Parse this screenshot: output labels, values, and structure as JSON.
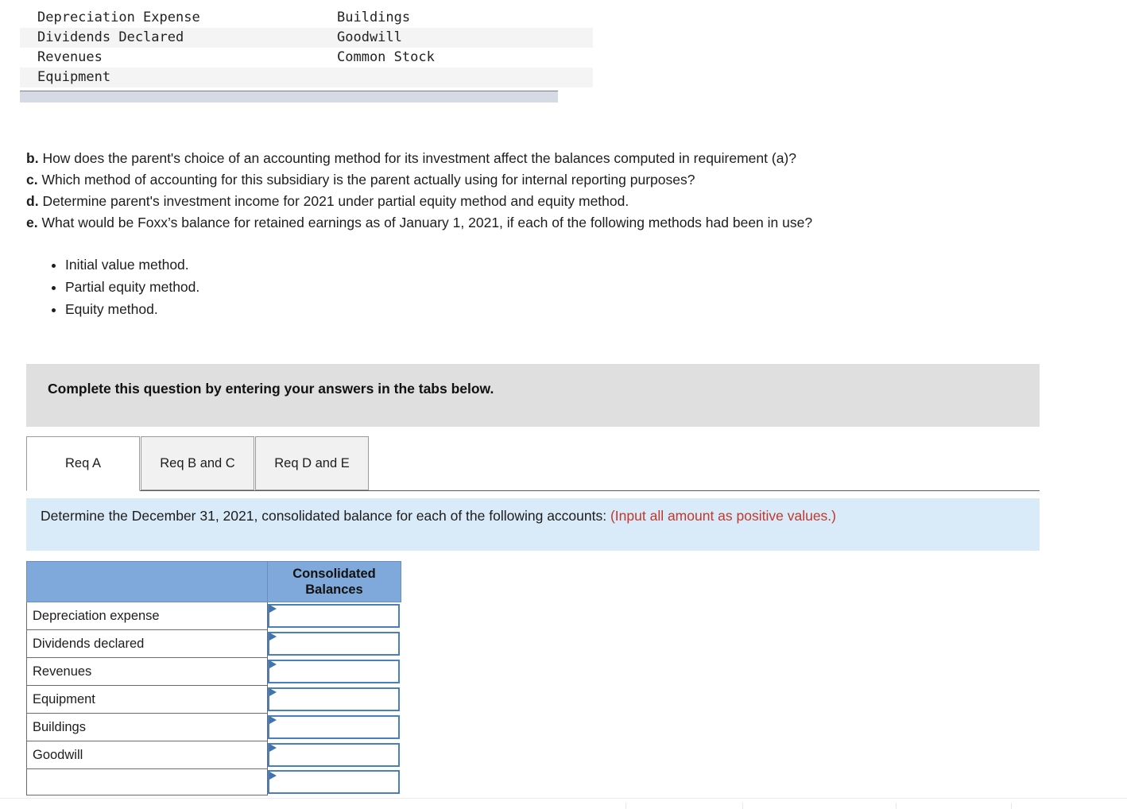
{
  "account_table": {
    "rows": [
      {
        "left": "Depreciation Expense",
        "right": "Buildings"
      },
      {
        "left": "Dividends Declared",
        "right": "Goodwill"
      },
      {
        "left": "Revenues",
        "right": "Common Stock"
      },
      {
        "left": "Equipment",
        "right": ""
      }
    ]
  },
  "questions": [
    {
      "letter": "b.",
      "text": "How does the parent's choice of an accounting method for its investment affect the balances computed in requirement (a)?"
    },
    {
      "letter": "c.",
      "text": "Which method of accounting for this subsidiary is the parent actually using for internal reporting purposes?"
    },
    {
      "letter": "d.",
      "text": "Determine parent's investment income for 2021 under partial equity method and equity method."
    },
    {
      "letter": "e.",
      "text": "What would be Foxx’s balance for retained earnings as of January 1, 2021, if each of the following methods had been in use?"
    }
  ],
  "methods": [
    "Initial value method.",
    "Partial equity method.",
    "Equity method."
  ],
  "gray_banner": {
    "text": "Complete this question by entering your answers in the tabs below."
  },
  "tabs": [
    {
      "label": "Req A",
      "active": true
    },
    {
      "label": "Req B and C",
      "active": false
    },
    {
      "label": "Req D and E",
      "active": false
    }
  ],
  "blue_banner": {
    "text_main": "Determine the December 31, 2021, consolidated balance for each of the following accounts: ",
    "text_red": "(Input all amount as positive values.)"
  },
  "answer_table": {
    "header_blank": "",
    "header_value_line1": "Consolidated",
    "header_value_line2": "Balances",
    "rows": [
      {
        "label": "Depreciation expense",
        "value": ""
      },
      {
        "label": "Dividends declared",
        "value": ""
      },
      {
        "label": "Revenues",
        "value": ""
      },
      {
        "label": "Equipment",
        "value": ""
      },
      {
        "label": "Buildings",
        "value": ""
      },
      {
        "label": "Goodwill",
        "value": ""
      }
    ],
    "input_placeholder": ""
  },
  "colors": {
    "header_blue": "#7fa9da",
    "banner_blue": "#d9eaf8",
    "banner_gray": "#dfdfdf",
    "red_note": "#c0392b",
    "input_border": "#3f74af"
  }
}
